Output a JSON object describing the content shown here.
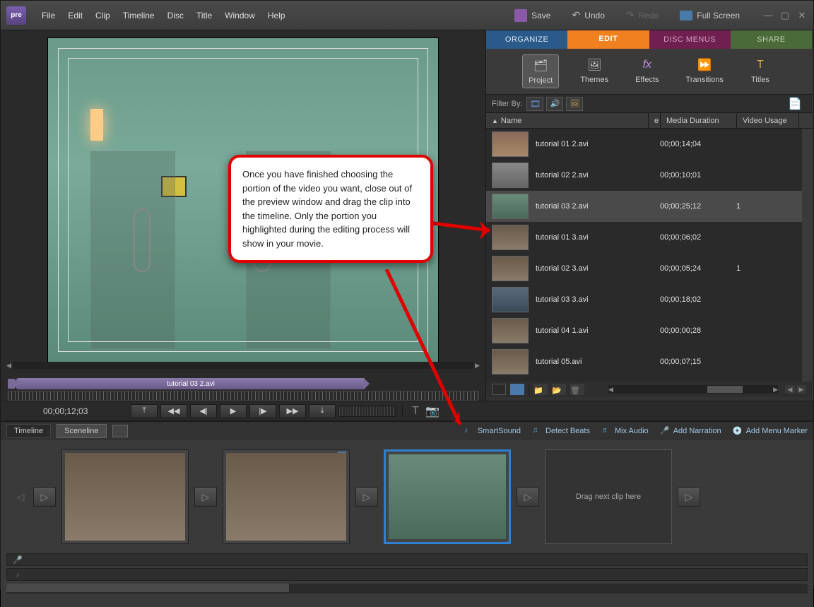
{
  "menu": {
    "items": [
      "File",
      "Edit",
      "Clip",
      "Timeline",
      "Disc",
      "Title",
      "Window",
      "Help"
    ]
  },
  "topActions": {
    "save": "Save",
    "undo": "Undo",
    "redo": "Redo",
    "fullscreen": "Full Screen"
  },
  "logo": "pre",
  "workspaceTabs": {
    "organize": "ORGANIZE",
    "edit": "EDIT",
    "disc": "DISC MENUS",
    "share": "SHARE"
  },
  "tools": {
    "project": "Project",
    "themes": "Themes",
    "effects": "Effects",
    "transitions": "Transitions",
    "titles": "Titles"
  },
  "filter": {
    "label": "Filter By:"
  },
  "mediaColumns": {
    "name": "Name",
    "middle": "e",
    "duration": "Media Duration",
    "usage": "Video Usage"
  },
  "mediaItems": [
    {
      "name": "tutorial 01 2.avi",
      "duration": "00;00;14;04",
      "usage": "",
      "thumb": "th-building"
    },
    {
      "name": "tutorial 02 2.avi",
      "duration": "00;00;10;01",
      "usage": "",
      "thumb": "th-corridor"
    },
    {
      "name": "tutorial 03 2.avi",
      "duration": "00;00;25;12",
      "usage": "1",
      "thumb": "th-door",
      "selected": true
    },
    {
      "name": "tutorial 01 3.avi",
      "duration": "00;00;06;02",
      "usage": "",
      "thumb": "th-lab"
    },
    {
      "name": "tutorial 02 3.avi",
      "duration": "00;00;05;24",
      "usage": "1",
      "thumb": "th-lab"
    },
    {
      "name": "tutorial 03 3.avi",
      "duration": "00;00;18;02",
      "usage": "",
      "thumb": "th-room"
    },
    {
      "name": "tutorial 04 1.avi",
      "duration": "00;00;00;28",
      "usage": "",
      "thumb": "th-lab"
    },
    {
      "name": "tutorial 05.avi",
      "duration": "00;00;07;15",
      "usage": "",
      "thumb": "th-lab"
    }
  ],
  "clipBar": {
    "name": "tutorial 03 2.avi"
  },
  "timecode": "00;00;12;03",
  "sceneTabs": {
    "timeline": "Timeline",
    "sceneline": "Sceneline"
  },
  "sceneActions": {
    "smartsound": "SmartSound",
    "detect": "Detect Beats",
    "mix": "Mix Audio",
    "narration": "Add Narration",
    "menumarker": "Add Menu Marker"
  },
  "sceneDrop": "Drag next clip here",
  "callout": "Once you have finished choosing the portion of the video you want, close out of the preview window and drag the clip into the timeline.  Only the portion you highlighted during the editing process will show in your movie."
}
